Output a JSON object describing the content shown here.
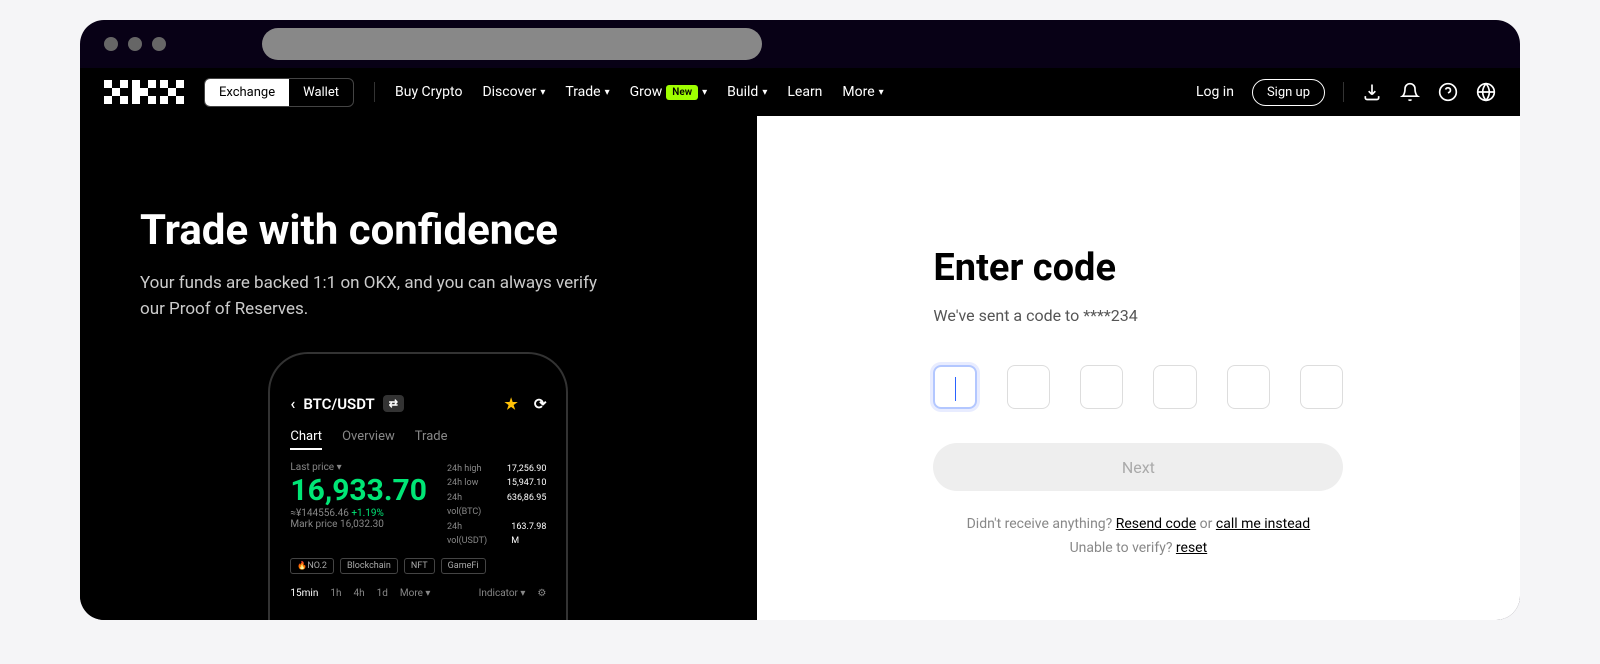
{
  "toggle": {
    "exchange": "Exchange",
    "wallet": "Wallet"
  },
  "nav": {
    "buy": "Buy Crypto",
    "discover": "Discover",
    "trade": "Trade",
    "grow": "Grow",
    "grow_badge": "New",
    "build": "Build",
    "learn": "Learn",
    "more": "More",
    "login": "Log in",
    "signup": "Sign up"
  },
  "hero": {
    "title": "Trade with confidence",
    "subtitle": "Your funds are backed 1:1 on OKX, and you can always verify our Proof of Reserves."
  },
  "phone": {
    "pair": "BTC/USDT",
    "tabs": {
      "chart": "Chart",
      "overview": "Overview",
      "trade": "Trade"
    },
    "last_price_label": "Last price",
    "price": "16,933.70",
    "sub_cny": "≈¥144556.46",
    "sub_pct": "+1.19%",
    "mark_price": "Mark price 16,032.30",
    "stats": {
      "high_label": "24h high",
      "high_val": "17,256.90",
      "low_label": "24h low",
      "low_val": "15,947.10",
      "volbtc_label": "24h vol(BTC)",
      "volbtc_val": "636,86.95",
      "volusdt_label": "24h vol(USDT)",
      "volusdt_val": "163.7.98 M"
    },
    "tags": [
      "NO.2",
      "Blockchain",
      "NFT",
      "GameFi"
    ],
    "timeframes": [
      "15min",
      "1h",
      "4h",
      "1d",
      "More"
    ],
    "indicator": "Indicator"
  },
  "form": {
    "title": "Enter code",
    "subtitle": "We've sent a code to ****234",
    "next": "Next",
    "help1_prefix": "Didn't receive anything? ",
    "resend": "Resend code",
    "help1_mid": " or ",
    "call": "call me instead",
    "help2_prefix": "Unable to verify? ",
    "reset": "reset"
  }
}
